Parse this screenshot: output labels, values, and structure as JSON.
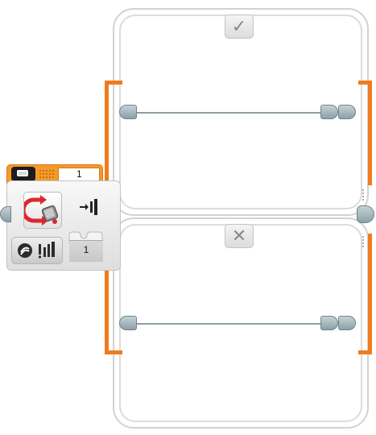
{
  "switch": {
    "true_case": {
      "icon": "checkmark-icon",
      "glyph": "✓"
    },
    "false_case": {
      "icon": "x-mark-icon",
      "glyph": "✕"
    }
  },
  "block": {
    "type": "Color Sensor Switch",
    "port_value": "1",
    "result_value": "1",
    "header_color": "#f39a2a",
    "mode_icon": "loop-arrow-sensor-icon",
    "compare_icon": "compare-color-icon",
    "output_icon": "output-arrow-icon"
  },
  "colors": {
    "accent": "#f07b1e",
    "frame_border": "#d2d2d2",
    "plug": "#8ca0a8"
  }
}
